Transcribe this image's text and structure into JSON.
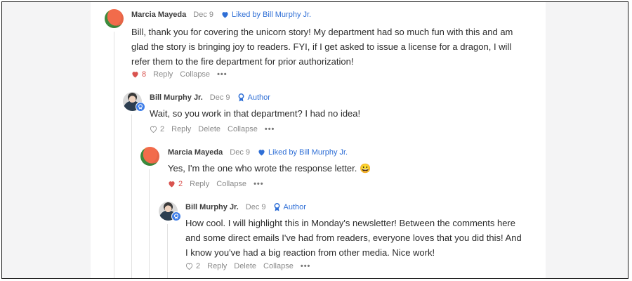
{
  "comments": [
    {
      "name": "Marcia Mayeda",
      "date": "Dec 9",
      "liked": "Liked by Bill Murphy Jr.",
      "text": "Bill, thank you for covering the unicorn story! My department had so much fun with this and am glad the story is bringing joy to readers. FYI, if I get asked to issue a license for a dragon, I will refer them to the fire department for prior authorization!",
      "likes": "8",
      "reply": "Reply",
      "collapse": "Collapse",
      "more": "•••"
    },
    {
      "name": "Bill Murphy Jr.",
      "date": "Dec 9",
      "author": "Author",
      "text": "Wait, so you work in that department? I had no idea!",
      "likes": "2",
      "reply": "Reply",
      "delete": "Delete",
      "collapse": "Collapse",
      "more": "•••"
    },
    {
      "name": "Marcia Mayeda",
      "date": "Dec 9",
      "liked": "Liked by Bill Murphy Jr.",
      "text": "Yes, I'm the one who wrote the response letter. 😀",
      "likes": "2",
      "reply": "Reply",
      "collapse": "Collapse",
      "more": "•••"
    },
    {
      "name": "Bill Murphy Jr.",
      "date": "Dec 9",
      "author": "Author",
      "text": "How cool. I will highlight this in Monday's newsletter! Between the comments here and some direct emails I've had from readers, everyone loves that you did this! And I know you've had a big reaction from other media. Nice work!",
      "likes": "2",
      "reply": "Reply",
      "delete": "Delete",
      "collapse": "Collapse",
      "more": "•••"
    }
  ],
  "colors": {
    "accent": "#2f6fd6",
    "heart": "#d9534f",
    "muted": "#8a8a8a"
  }
}
